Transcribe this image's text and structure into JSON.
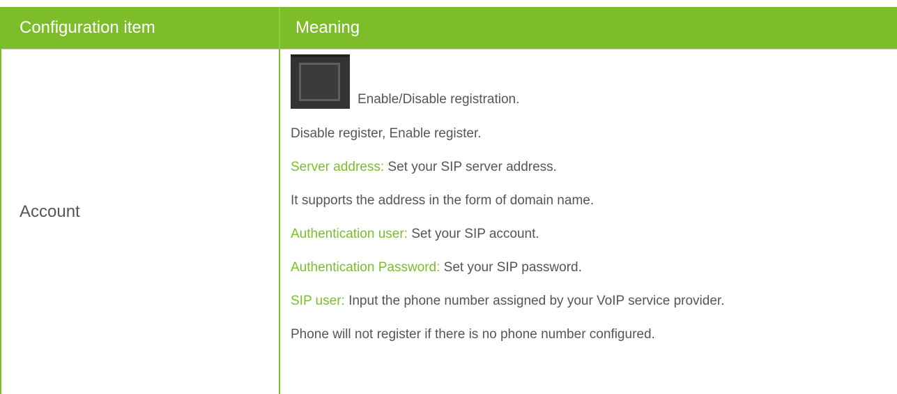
{
  "header": {
    "col1": "Configuration item",
    "col2": "Meaning"
  },
  "row": {
    "item": "Account",
    "lines": [
      {
        "label": "",
        "text": "Enable/Disable registration."
      },
      {
        "label": "",
        "text": "Disable register, Enable register."
      },
      {
        "label": "Server address:",
        "text": " Set your SIP server address."
      },
      {
        "label": "",
        "text": "It supports the address in the form of domain name."
      },
      {
        "label": "Authentication user:",
        "text": " Set your SIP account."
      },
      {
        "label": "Authentication Password:",
        "text": " Set your SIP password."
      },
      {
        "label": "SIP user:",
        "text": " Input the phone number assigned by your VoIP service provider."
      },
      {
        "label": "",
        "text": "Phone will not register if there is no phone number configured."
      }
    ]
  },
  "colors": {
    "accent": "#7dbd2a",
    "text": "#555555",
    "header_text": "#ffffff"
  },
  "icons": {
    "checkbox": "checkbox-icon"
  }
}
